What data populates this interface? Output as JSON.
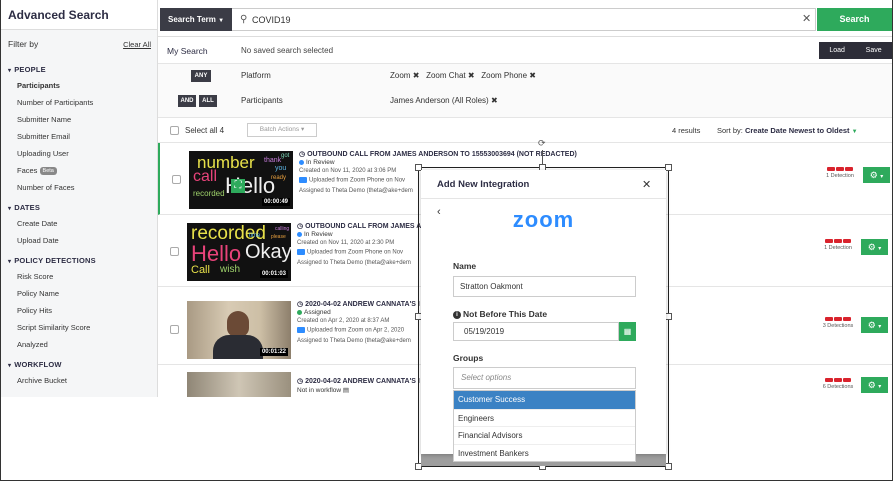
{
  "sidebar": {
    "title": "Advanced Search",
    "filter_by": "Filter by",
    "clear_all": "Clear All",
    "sections": [
      {
        "label": "PEOPLE",
        "items": [
          {
            "label": "Participants",
            "bold": true
          },
          {
            "label": "Number of Participants"
          },
          {
            "label": "Submitter Name"
          },
          {
            "label": "Submitter Email"
          },
          {
            "label": "Uploading User"
          },
          {
            "label": "Faces",
            "badge": "Beta"
          },
          {
            "label": "Number of Faces"
          }
        ]
      },
      {
        "label": "DATES",
        "items": [
          {
            "label": "Create Date"
          },
          {
            "label": "Upload Date"
          }
        ]
      },
      {
        "label": "POLICY DETECTIONS",
        "items": [
          {
            "label": "Risk Score"
          },
          {
            "label": "Policy Name"
          },
          {
            "label": "Policy Hits"
          },
          {
            "label": "Script Similarity Score"
          },
          {
            "label": "Analyzed"
          }
        ]
      },
      {
        "label": "WORKFLOW",
        "items": [
          {
            "label": "Archive Bucket"
          }
        ]
      }
    ]
  },
  "search": {
    "term_label": "Search Term",
    "value": "COVID19",
    "button": "Search"
  },
  "my_search": {
    "label": "My Search",
    "value": "No saved search selected",
    "load": "Load",
    "save": "Save"
  },
  "filters": {
    "row1": {
      "tag": "ANY",
      "name": "Platform",
      "values": [
        "Zoom",
        "Zoom Chat",
        "Zoom Phone"
      ]
    },
    "row2": {
      "tag_and": "AND",
      "tag_all": "ALL",
      "name": "Participants",
      "values": [
        "James Anderson (All Roles)"
      ]
    }
  },
  "results_header": {
    "select_all": "Select all 4",
    "batch_actions": "Batch Actions",
    "count": "4 results",
    "sort_prefix": "Sort by:",
    "sort_value": "Create Date Newest to Oldest"
  },
  "rows": [
    {
      "title": "OUTBOUND CALL FROM JAMES ANDERSON TO 15553003694 (NOT REDACTED)",
      "status": "In Review",
      "status_color": "#2d8cff",
      "created": "Created on Nov 11, 2020 at 3:06 PM",
      "upload": "Uploaded from Zoom Phone on Nov",
      "assigned": "Assigned to Theta Demo (theta@ake+dem",
      "duration": "00:00:49",
      "detections": "1 Detection",
      "words": [
        "number",
        "call",
        "Hello",
        "recorded",
        "thank",
        "you",
        "ready",
        "got"
      ]
    },
    {
      "title": "OUTBOUND CALL FROM JAMES AN",
      "status": "In Review",
      "status_color": "#2d8cff",
      "created": "Created on Nov 11, 2020 at 2:30 PM",
      "upload": "Uploaded from Zoom Phone on Nov",
      "assigned": "Assigned to Theta Demo (theta@ake+dem",
      "duration": "00:01:03",
      "detections": "1 Detection",
      "words": [
        "recorded",
        "Hello",
        "Okay",
        "Call",
        "wish",
        "calling",
        "time",
        "please"
      ]
    },
    {
      "title": "2020-04-02 ANDREW CANNATA'S I",
      "status": "Assigned",
      "status_color": "#2eaa5c",
      "created": "Created on Apr 2, 2020 at 8:37 AM",
      "upload": "Uploaded from Zoom on Apr 2, 2020",
      "assigned": "Assigned to Theta Demo (theta@ake+dem",
      "duration": "00:01:22",
      "detections": "3 Detections"
    },
    {
      "title": "2020-04-02 ANDREW CANNATA'S I",
      "status": "Not in workflow",
      "detections": "6 Detections"
    }
  ],
  "modal": {
    "title": "Add New Integration",
    "logo": "zoom",
    "name_label": "Name",
    "name_value": "Stratton Oakmont",
    "date_label": "Not Before This Date",
    "date_value": "05/19/2019",
    "groups_label": "Groups",
    "groups_placeholder": "Select options",
    "options": [
      "Customer Success",
      "Engineers",
      "Financial Advisors",
      "Investment Bankers"
    ],
    "selected_option": "Customer Success"
  },
  "colors": {
    "accent_green": "#2eaa5c",
    "dark": "#3b3c46",
    "zoom_blue": "#2d8cff",
    "detection_red": "#d9232d",
    "selected_blue": "#3b82c4"
  }
}
